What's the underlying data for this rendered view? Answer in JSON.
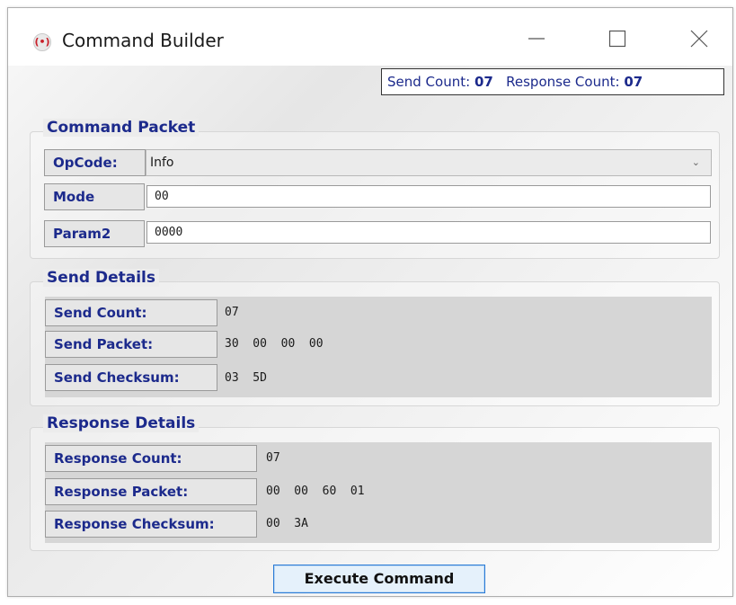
{
  "window": {
    "title": "Command Builder",
    "icon": "app-red-circle-icon"
  },
  "counts": {
    "send_label": "Send Count:",
    "send_value": "07",
    "response_label": "Response Count:",
    "response_value": "07"
  },
  "command_packet": {
    "title": "Command Packet",
    "opcode_label": "OpCode:",
    "opcode_value": "Info",
    "mode_label": "Mode",
    "mode_value": "00",
    "param2_label": "Param2",
    "param2_value": "0000"
  },
  "send_details": {
    "title": "Send Details",
    "rows": [
      {
        "label": "Send Count:",
        "value": "07"
      },
      {
        "label": "Send Packet:",
        "value": "30  00  00  00"
      },
      {
        "label": "Send Checksum:",
        "value": "03  5D"
      }
    ]
  },
  "response_details": {
    "title": "Response Details",
    "rows": [
      {
        "label": "Response Count:",
        "value": "07"
      },
      {
        "label": "Response Packet:",
        "value": "00  00  60  01"
      },
      {
        "label": "Response Checksum:",
        "value": "00  3A"
      }
    ]
  },
  "execute_button": "Execute Command",
  "colors": {
    "label_text": "#1c2a8c",
    "button_border": "#2a7bd6",
    "panel_bg": "#d6d6d6"
  }
}
